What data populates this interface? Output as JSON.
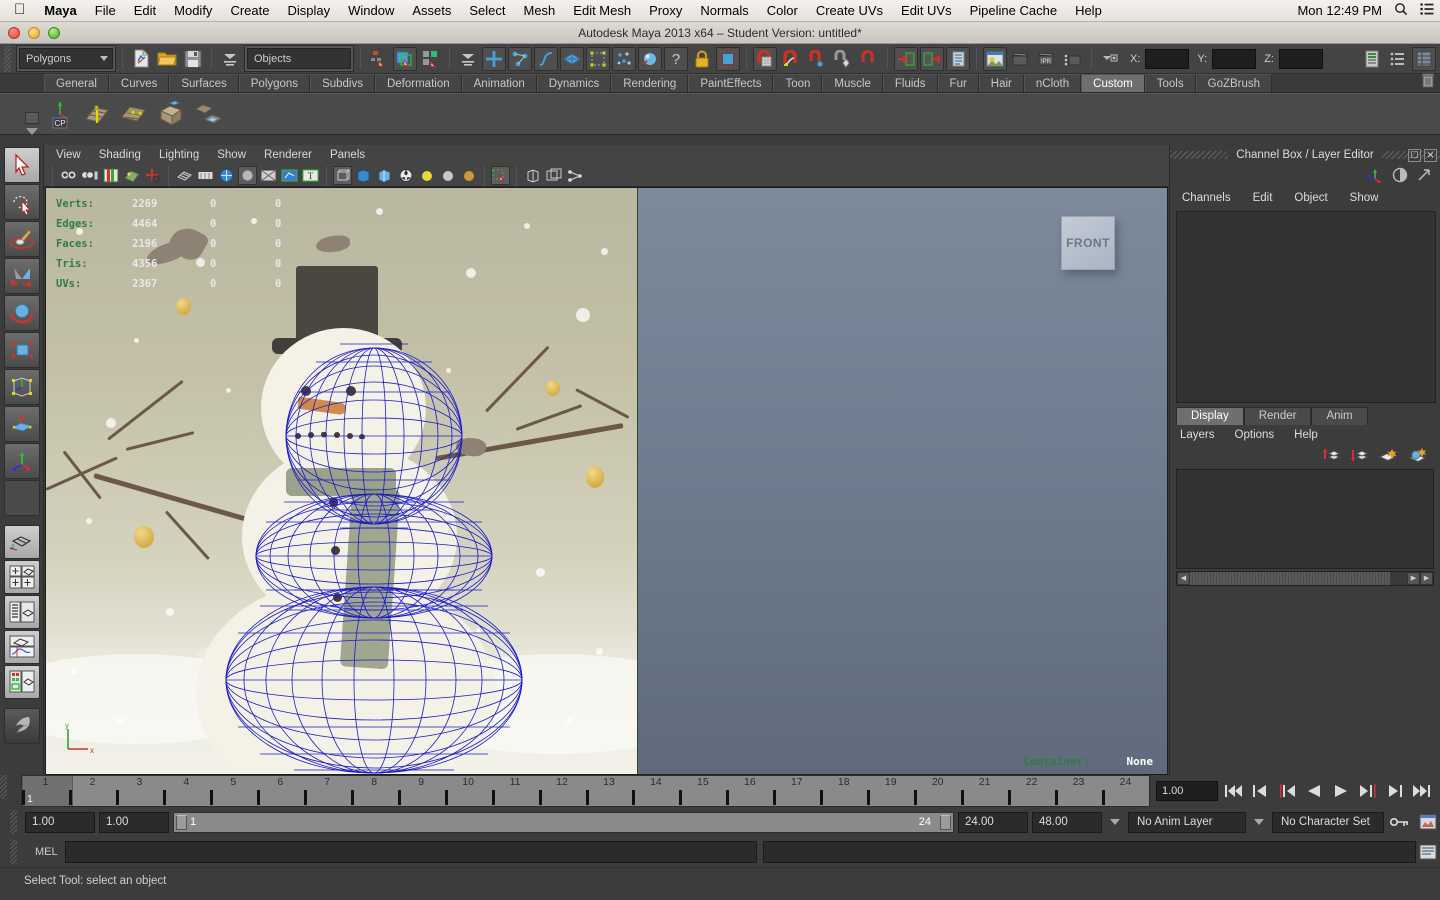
{
  "os_menu": {
    "apple_icon": "apple-logo",
    "items": [
      "Maya",
      "File",
      "Edit",
      "Modify",
      "Create",
      "Display",
      "Window",
      "Assets",
      "Select",
      "Mesh",
      "Edit Mesh",
      "Proxy",
      "Normals",
      "Color",
      "Create UVs",
      "Edit UVs",
      "Pipeline Cache",
      "Help"
    ],
    "clock": "Mon 12:49 PM",
    "search_icon": "search-icon",
    "list_icon": "list-icon"
  },
  "window": {
    "title": "Autodesk Maya 2013 x64 – Student Version: untitled*"
  },
  "status_bar": {
    "menuset": "Polygons",
    "selection_mask": "Objects",
    "x_label": "X:",
    "y_label": "Y:",
    "z_label": "Z:",
    "x_value": "",
    "y_value": "",
    "z_value": "",
    "icons": [
      "new-scene-icon",
      "open-scene-icon",
      "save-scene-icon",
      "select-hierarchy-icon",
      "select-object-icon",
      "select-component-icon",
      "select-by-handle-icon",
      "select-by-point-icon",
      "select-by-curve-icon",
      "select-by-surface-icon",
      "select-by-deformation-icon",
      "select-by-dynamic-icon",
      "select-by-rendering-icon",
      "select-misc-icon",
      "lock-icon",
      "snap-grid-icon",
      "snap-curve-icon",
      "snap-point-icon",
      "snap-view-icon",
      "snap-projected-icon",
      "input-connections-icon",
      "output-connections-icon",
      "construction-history-icon",
      "render-view-icon",
      "render-sequence-icon",
      "ipr-render-icon",
      "render-settings-icon",
      "editor-toggle-icon",
      "attribute-editor-icon",
      "tool-settings-icon",
      "channel-box-icon"
    ]
  },
  "shelf": {
    "tabs": [
      "General",
      "Curves",
      "Surfaces",
      "Polygons",
      "Subdivs",
      "Deformation",
      "Animation",
      "Dynamics",
      "Rendering",
      "PaintEffects",
      "Toon",
      "Muscle",
      "Fluids",
      "Fur",
      "Hair",
      "nCloth",
      "Custom",
      "Tools",
      "GoZBrush"
    ],
    "active_tab": "Custom",
    "trash_icon": "trash-icon",
    "buttons": [
      "cp-axis-icon",
      "polygon-strip-icon",
      "polygon-patch-icon",
      "polygon-cube-icon",
      "polygon-plane-icon"
    ]
  },
  "toolbox": {
    "items": [
      {
        "name": "select-tool",
        "icon": "arrow-cursor-icon",
        "active": true
      },
      {
        "name": "lasso-tool",
        "icon": "lasso-icon",
        "active": false
      },
      {
        "name": "paint-select-tool",
        "icon": "paint-brush-icon",
        "active": false
      },
      {
        "name": "move-tool",
        "icon": "move-arrow-icon",
        "active": false
      },
      {
        "name": "rotate-tool",
        "icon": "rotate-sphere-icon",
        "active": false
      },
      {
        "name": "scale-tool",
        "icon": "scale-cube-icon",
        "active": false
      },
      {
        "name": "universal-manip-tool",
        "icon": "universal-manipulator-icon",
        "active": false
      },
      {
        "name": "soft-mod-tool",
        "icon": "soft-modification-icon",
        "active": false
      },
      {
        "name": "last-tool",
        "icon": "axis-tripod-icon",
        "active": false
      },
      {
        "name": "single-perspective-layout",
        "icon": "single-view-icon",
        "active": false
      },
      {
        "name": "four-view-layout",
        "icon": "four-view-icon",
        "active": false
      },
      {
        "name": "outliner-persp-layout",
        "icon": "outliner-persp-icon",
        "active": false
      },
      {
        "name": "persp-graph-layout",
        "icon": "persp-graph-icon",
        "active": false
      },
      {
        "name": "hypershade-persp-layout",
        "icon": "hypershade-persp-icon",
        "active": false
      },
      {
        "name": "paint-effects-logo",
        "icon": "maya-paint-logo-icon",
        "active": false
      }
    ]
  },
  "viewport": {
    "menus": [
      "View",
      "Shading",
      "Lighting",
      "Show",
      "Renderer",
      "Panels"
    ],
    "toolbar_icons": [
      "select-camera-icon",
      "camera-attributes-icon",
      "bookmark-icon",
      "image-plane-icon",
      "two-d-pan-zoom-icon",
      "grid-toggle-icon",
      "film-gate-icon",
      "resolution-gate-icon",
      "gate-mask-icon",
      "xray-icon",
      "xray-joints-icon",
      "texture-toggle-icon",
      "wireframe-shading-icon",
      "smooth-shade-all-icon",
      "smooth-shade-textured-icon",
      "hardware-texturing-icon",
      "light-none-icon",
      "light-default-icon",
      "light-all-icon",
      "isolate-select-icon",
      "shadows-icon",
      "exposure-icon",
      "gamma-icon"
    ],
    "hud": {
      "columns": 3,
      "rows": [
        {
          "label": "Verts:",
          "v1": "2269",
          "v2": "0",
          "v3": "0"
        },
        {
          "label": "Edges:",
          "v1": "4464",
          "v2": "0",
          "v3": "0"
        },
        {
          "label": "Faces:",
          "v1": "2196",
          "v2": "0",
          "v3": "0"
        },
        {
          "label": "Tris:",
          "v1": "4356",
          "v2": "0",
          "v3": "0"
        },
        {
          "label": "UVs:",
          "v1": "2367",
          "v2": "0",
          "v3": "0"
        }
      ]
    },
    "viewcube_label": "FRONT",
    "container_label": "Container:",
    "container_value": "None",
    "axis_labels": {
      "y": "y",
      "x": "x"
    },
    "scene_description": "Front orthographic view of a polygon snowman mesh (blue wireframe) over an image plane of a painted winter snowman scene with birds, bare branches and gold baubles"
  },
  "channel_box": {
    "title": "Channel Box / Layer Editor",
    "header_icons": [
      "restore-panel-icon",
      "close-panel-icon"
    ],
    "toolbar_icons": [
      "channel-box-icon",
      "attribute-editor-icon",
      "expand-icon"
    ],
    "menus": [
      "Channels",
      "Edit",
      "Object",
      "Show"
    ]
  },
  "layer_editor": {
    "tabs": [
      "Display",
      "Render",
      "Anim"
    ],
    "active_tab": "Display",
    "menus": [
      "Layers",
      "Options",
      "Help"
    ],
    "icons": [
      "move-layer-up-icon",
      "move-layer-down-icon",
      "new-layer-icon",
      "new-layer-from-selected-icon"
    ]
  },
  "timeline": {
    "ticks": [
      "1",
      "2",
      "3",
      "4",
      "5",
      "6",
      "7",
      "8",
      "9",
      "10",
      "11",
      "12",
      "13",
      "14",
      "15",
      "16",
      "17",
      "18",
      "19",
      "20",
      "21",
      "22",
      "23",
      "24"
    ],
    "current_frame": "1",
    "current_frame_field": "1.00",
    "playback_buttons": [
      "go-to-start-icon",
      "step-back-frame-icon",
      "step-back-key-icon",
      "play-backwards-icon",
      "play-forwards-icon",
      "step-forward-key-icon",
      "step-forward-frame-icon",
      "go-to-end-icon"
    ]
  },
  "range_bar": {
    "anim_start": "1.00",
    "range_start": "1.00",
    "slider_min": "1",
    "slider_max": "24",
    "range_end": "24.00",
    "anim_end": "48.00",
    "anim_layer": "No Anim Layer",
    "character_set": "No Character Set",
    "key_icon": "auto-key-icon",
    "prefs_icon": "animation-preferences-icon"
  },
  "command_line": {
    "label": "MEL",
    "input_value": "",
    "script_editor_icon": "script-editor-icon"
  },
  "help_line": {
    "text": "Select Tool: select an object"
  },
  "colors": {
    "chrome": "#3c3c3c",
    "panel": "#444444",
    "active_tab": "#6f6f6f",
    "hud_label": "#2f7d3f",
    "wireframe": "#1b1bcc",
    "viewport_bg": "#6f7d90"
  }
}
